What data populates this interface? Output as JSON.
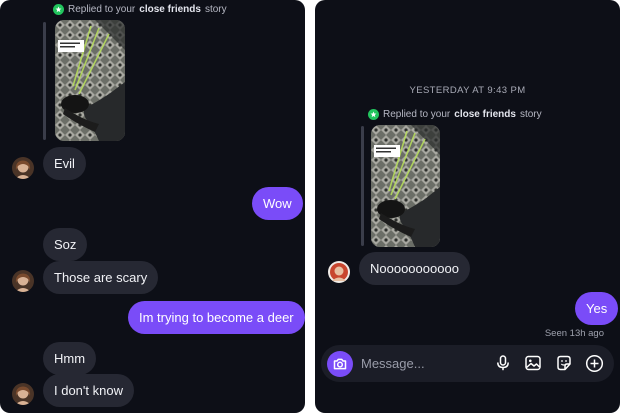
{
  "left": {
    "replied_prefix": "Replied to your",
    "replied_story": "close friends",
    "replied_suffix": "story",
    "messages": [
      {
        "text": "Evil"
      },
      {
        "text": "Wow"
      },
      {
        "text": "Soz"
      },
      {
        "text": "Those are scary"
      },
      {
        "text": "Im trying to become a deer"
      },
      {
        "text": "Hmm"
      },
      {
        "text": "I don't know"
      }
    ]
  },
  "right": {
    "timestamp": "YESTERDAY AT 9:43 PM",
    "replied_prefix": "Replied to your",
    "replied_story": "close friends",
    "replied_suffix": "story",
    "messages": [
      {
        "text": "Nooooooooooo"
      },
      {
        "text": "Yes"
      }
    ],
    "seen": "Seen 13h ago",
    "composer": {
      "placeholder": "Message...",
      "icons": [
        "camera-icon",
        "microphone-icon",
        "image-icon",
        "sticker-icon",
        "plus-icon"
      ]
    }
  },
  "colors": {
    "background": "#0d0f17",
    "incoming_bubble": "#262833",
    "outgoing_bubble": "#7a4cf8",
    "close_friends_badge": "#22c55e"
  }
}
